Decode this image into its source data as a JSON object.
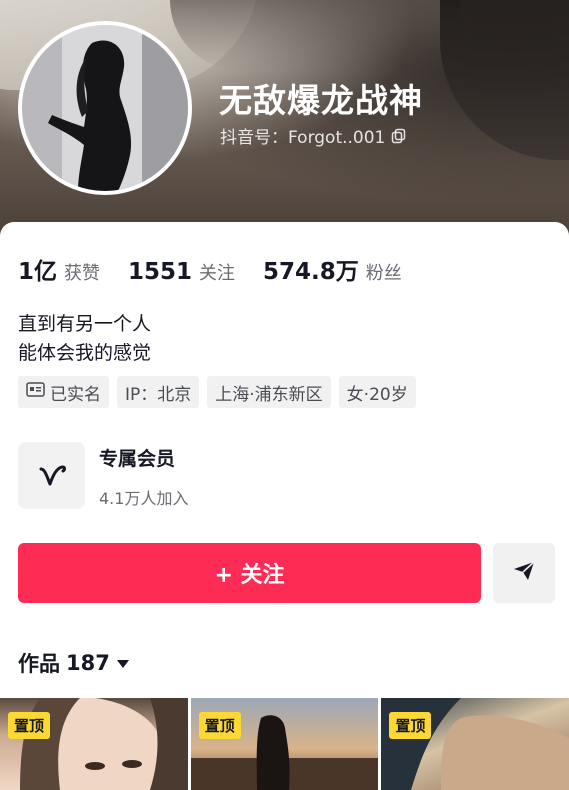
{
  "profile": {
    "nickname": "无敌爆龙战神",
    "douyin_id": "抖音号：Forgot..001"
  },
  "stats": [
    {
      "value": "1亿",
      "label": "获赞"
    },
    {
      "value": "1551",
      "label": "关注"
    },
    {
      "value": "574.8万",
      "label": "粉丝"
    }
  ],
  "bio": {
    "line1": "直到有另一个人",
    "line2": "能体会我的感觉"
  },
  "tags": {
    "verified": "已实名",
    "ip": "IP：北京",
    "location": "上海·浦东新区",
    "gender_age": "女·20岁"
  },
  "vip": {
    "title": "专属会员",
    "subtitle": "4.1万人加入"
  },
  "actions": {
    "follow_label": "+ 关注"
  },
  "works": {
    "label": "作品",
    "count": "187"
  },
  "thumbnails": [
    {
      "badge": "置顶"
    },
    {
      "badge": "置顶"
    },
    {
      "badge": "置顶"
    }
  ],
  "colors": {
    "accent": "#fe2c55",
    "pin_badge": "#fcd835"
  },
  "icons": [
    "copy-icon",
    "id-card-icon",
    "vip-v-icon",
    "share-arrow-icon",
    "dropdown-caret-icon"
  ]
}
